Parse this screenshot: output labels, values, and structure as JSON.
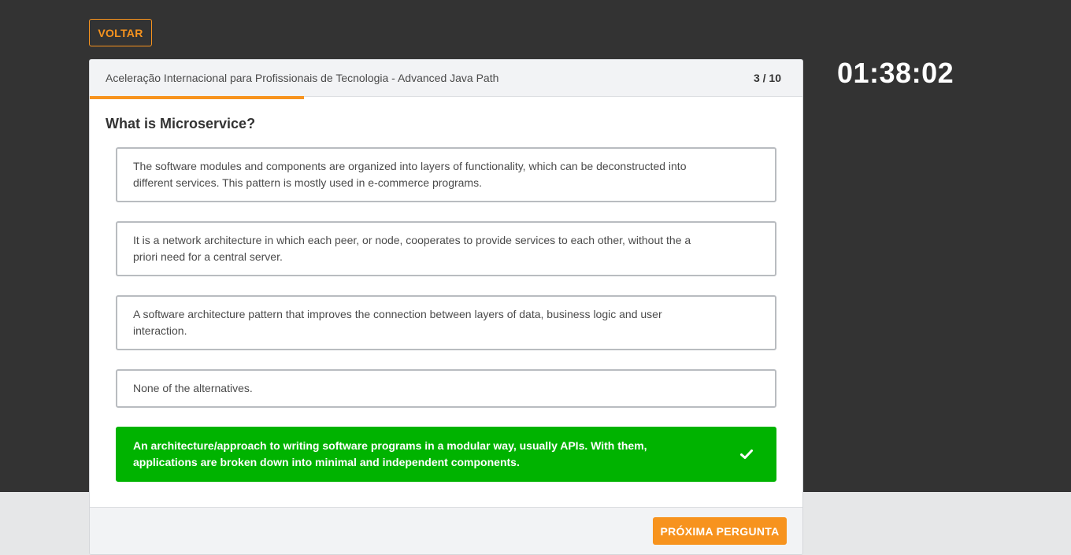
{
  "header": {
    "back_label": "VOLTAR",
    "timer": "01:38:02"
  },
  "quiz": {
    "course_title": "Aceleração Internacional para Profissionais de Tecnologia - Advanced Java Path",
    "progress_text": "3 / 10",
    "progress_fraction": 0.3,
    "question": "What is Microservice?",
    "options": [
      {
        "text": "The software modules and components are organized into layers of functionality, which can be deconstructed into different services. This pattern is mostly used in e-commerce programs.",
        "state": "default"
      },
      {
        "text": "It is a network architecture in which each peer, or node, cooperates to provide services to each other, without the a priori need for a central server.",
        "state": "default"
      },
      {
        "text": "A software architecture pattern that improves the connection between layers of data, business logic and user interaction.",
        "state": "default"
      },
      {
        "text": "None of the alternatives.",
        "state": "default"
      },
      {
        "text": "An architecture/approach to writing software programs in a modular way, usually APIs. With them, applications are broken down into minimal and independent components.",
        "state": "correct",
        "icon": "check-icon"
      }
    ],
    "next_label": "PRÓXIMA PERGUNTA"
  },
  "colors": {
    "accent": "#f7931e",
    "correct": "#00b300",
    "background_dark": "#333333"
  }
}
